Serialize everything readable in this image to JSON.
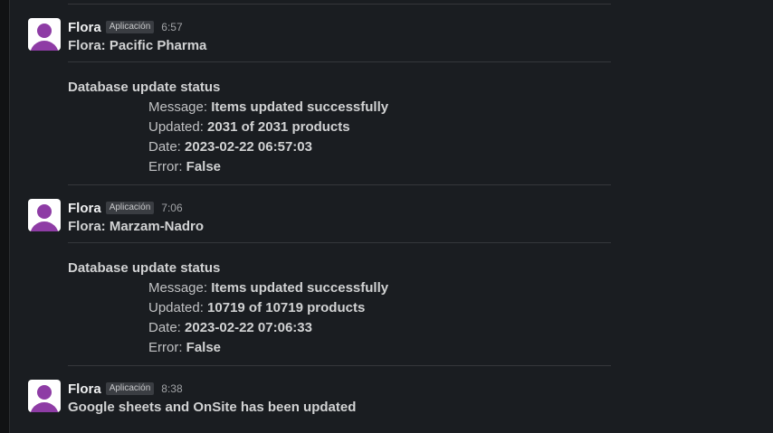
{
  "messages": [
    {
      "sender": "Flora",
      "badge": "Aplicación",
      "time": "6:57",
      "text": "Flora: Pacific Pharma",
      "attachment": {
        "title": "Database update status",
        "fields": [
          {
            "label": "Message: ",
            "value": "Items updated successfully"
          },
          {
            "label": "Updated: ",
            "value": "2031 of 2031 products"
          },
          {
            "label": "Date: ",
            "value": "2023-02-22 06:57:03"
          },
          {
            "label": "Error: ",
            "value": "False"
          }
        ]
      }
    },
    {
      "sender": "Flora",
      "badge": "Aplicación",
      "time": "7:06",
      "text": "Flora: Marzam-Nadro",
      "attachment": {
        "title": "Database update status",
        "fields": [
          {
            "label": "Message: ",
            "value": "Items updated successfully"
          },
          {
            "label": "Updated: ",
            "value": "10719 of 10719 products"
          },
          {
            "label": "Date: ",
            "value": "2023-02-22 07:06:33"
          },
          {
            "label": "Error: ",
            "value": "False"
          }
        ]
      }
    },
    {
      "sender": "Flora",
      "badge": "Aplicación",
      "time": "8:38",
      "text": "Google sheets and OnSite has been updated"
    }
  ],
  "colors": {
    "background": "#1a1d21",
    "avatar_accent": "#8e3ca5",
    "text": "#d1d2d3"
  }
}
